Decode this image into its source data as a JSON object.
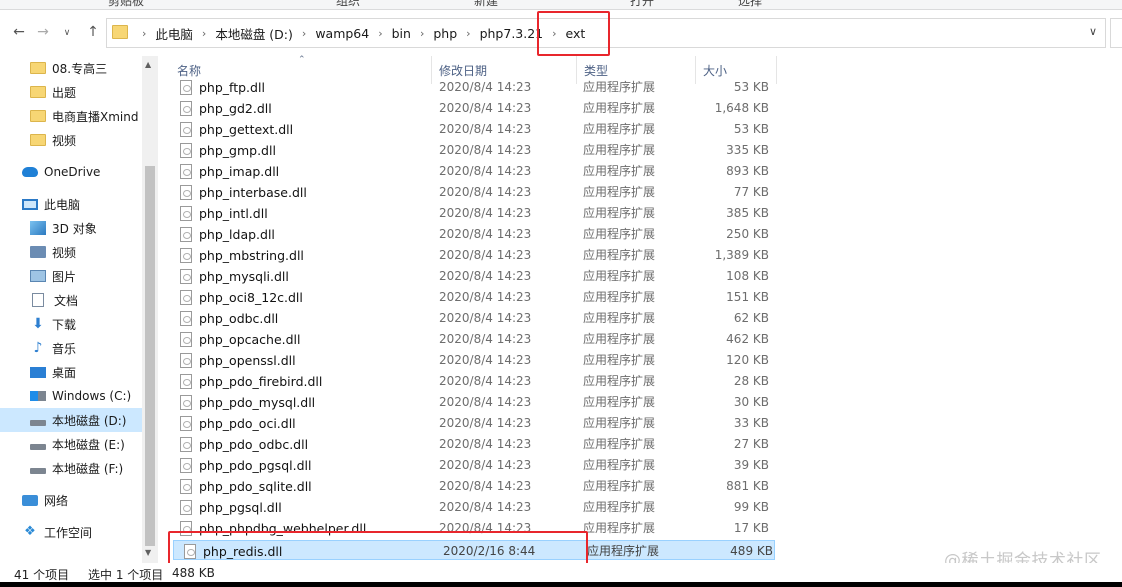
{
  "ribbon": {
    "labels": [
      "剪贴板",
      "组织",
      "新建",
      "打开",
      "选择"
    ]
  },
  "address": {
    "crumbs": [
      "此电脑",
      "本地磁盘 (D:)",
      "wamp64",
      "bin",
      "php",
      "php7.3.21",
      "ext"
    ],
    "back_icon": "arrow-left-icon",
    "forward_icon": "arrow-right-icon",
    "recent_icon": "chevron-down-icon",
    "up_icon": "arrow-up-icon"
  },
  "sidebar": {
    "items": [
      {
        "label": "08.专高三",
        "icon": "folder-icon"
      },
      {
        "label": "出题",
        "icon": "folder-icon"
      },
      {
        "label": "电商直播Xmind",
        "icon": "folder-icon"
      },
      {
        "label": "视频",
        "icon": "folder-icon"
      },
      {
        "label": "OneDrive",
        "icon": "cloud-icon"
      },
      {
        "label": "此电脑",
        "icon": "computer-icon"
      },
      {
        "label": "3D 对象",
        "icon": "3d-objects-icon"
      },
      {
        "label": "视频",
        "icon": "video-icon"
      },
      {
        "label": "图片",
        "icon": "picture-icon"
      },
      {
        "label": "文档",
        "icon": "document-icon"
      },
      {
        "label": "下载",
        "icon": "download-icon"
      },
      {
        "label": "音乐",
        "icon": "music-icon"
      },
      {
        "label": "桌面",
        "icon": "desktop-icon"
      },
      {
        "label": "Windows (C:)",
        "icon": "windows-drive-icon"
      },
      {
        "label": "本地磁盘 (D:)",
        "icon": "drive-icon"
      },
      {
        "label": "本地磁盘 (E:)",
        "icon": "drive-icon"
      },
      {
        "label": "本地磁盘 (F:)",
        "icon": "drive-icon"
      },
      {
        "label": "网络",
        "icon": "network-icon"
      },
      {
        "label": "工作空间",
        "icon": "workspace-icon"
      }
    ]
  },
  "columns": {
    "name": "名称",
    "date": "修改日期",
    "type": "类型",
    "size": "大小"
  },
  "files": [
    {
      "name": "php_ftp.dll",
      "date": "2020/8/4 14:23",
      "type": "应用程序扩展",
      "size": "53 KB"
    },
    {
      "name": "php_gd2.dll",
      "date": "2020/8/4 14:23",
      "type": "应用程序扩展",
      "size": "1,648 KB"
    },
    {
      "name": "php_gettext.dll",
      "date": "2020/8/4 14:23",
      "type": "应用程序扩展",
      "size": "53 KB"
    },
    {
      "name": "php_gmp.dll",
      "date": "2020/8/4 14:23",
      "type": "应用程序扩展",
      "size": "335 KB"
    },
    {
      "name": "php_imap.dll",
      "date": "2020/8/4 14:23",
      "type": "应用程序扩展",
      "size": "893 KB"
    },
    {
      "name": "php_interbase.dll",
      "date": "2020/8/4 14:23",
      "type": "应用程序扩展",
      "size": "77 KB"
    },
    {
      "name": "php_intl.dll",
      "date": "2020/8/4 14:23",
      "type": "应用程序扩展",
      "size": "385 KB"
    },
    {
      "name": "php_ldap.dll",
      "date": "2020/8/4 14:23",
      "type": "应用程序扩展",
      "size": "250 KB"
    },
    {
      "name": "php_mbstring.dll",
      "date": "2020/8/4 14:23",
      "type": "应用程序扩展",
      "size": "1,389 KB"
    },
    {
      "name": "php_mysqli.dll",
      "date": "2020/8/4 14:23",
      "type": "应用程序扩展",
      "size": "108 KB"
    },
    {
      "name": "php_oci8_12c.dll",
      "date": "2020/8/4 14:23",
      "type": "应用程序扩展",
      "size": "151 KB"
    },
    {
      "name": "php_odbc.dll",
      "date": "2020/8/4 14:23",
      "type": "应用程序扩展",
      "size": "62 KB"
    },
    {
      "name": "php_opcache.dll",
      "date": "2020/8/4 14:23",
      "type": "应用程序扩展",
      "size": "462 KB"
    },
    {
      "name": "php_openssl.dll",
      "date": "2020/8/4 14:23",
      "type": "应用程序扩展",
      "size": "120 KB"
    },
    {
      "name": "php_pdo_firebird.dll",
      "date": "2020/8/4 14:23",
      "type": "应用程序扩展",
      "size": "28 KB"
    },
    {
      "name": "php_pdo_mysql.dll",
      "date": "2020/8/4 14:23",
      "type": "应用程序扩展",
      "size": "30 KB"
    },
    {
      "name": "php_pdo_oci.dll",
      "date": "2020/8/4 14:23",
      "type": "应用程序扩展",
      "size": "33 KB"
    },
    {
      "name": "php_pdo_odbc.dll",
      "date": "2020/8/4 14:23",
      "type": "应用程序扩展",
      "size": "27 KB"
    },
    {
      "name": "php_pdo_pgsql.dll",
      "date": "2020/8/4 14:23",
      "type": "应用程序扩展",
      "size": "39 KB"
    },
    {
      "name": "php_pdo_sqlite.dll",
      "date": "2020/8/4 14:23",
      "type": "应用程序扩展",
      "size": "881 KB"
    },
    {
      "name": "php_pgsql.dll",
      "date": "2020/8/4 14:23",
      "type": "应用程序扩展",
      "size": "99 KB"
    },
    {
      "name": "php_phpdbg_webhelper.dll",
      "date": "2020/8/4 14:23",
      "type": "应用程序扩展",
      "size": "17 KB"
    },
    {
      "name": "php_redis.dll",
      "date": "2020/2/16 8:44",
      "type": "应用程序扩展",
      "size": "489 KB",
      "selected": true
    }
  ],
  "status": {
    "count": "41 个项目",
    "selection": "选中 1 个项目",
    "size": "488 KB"
  },
  "watermark": "@稀土掘金技术社区",
  "colors": {
    "highlight_border": "#e8262c",
    "selection_bg": "#cce8ff",
    "header_text": "#4d6185"
  }
}
